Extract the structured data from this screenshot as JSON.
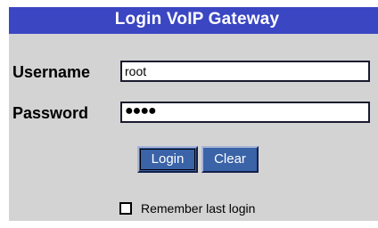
{
  "title": "Login VoIP Gateway",
  "username": {
    "label": "Username",
    "value": "root"
  },
  "password": {
    "label": "Password",
    "value": "●●●●"
  },
  "buttons": {
    "login": "Login",
    "clear": "Clear"
  },
  "remember": {
    "label": "Remember last login",
    "checked": false
  },
  "colors": {
    "title_bar": "#3a46c2",
    "panel": "#d3d3d3",
    "button": "#3a63a8"
  }
}
